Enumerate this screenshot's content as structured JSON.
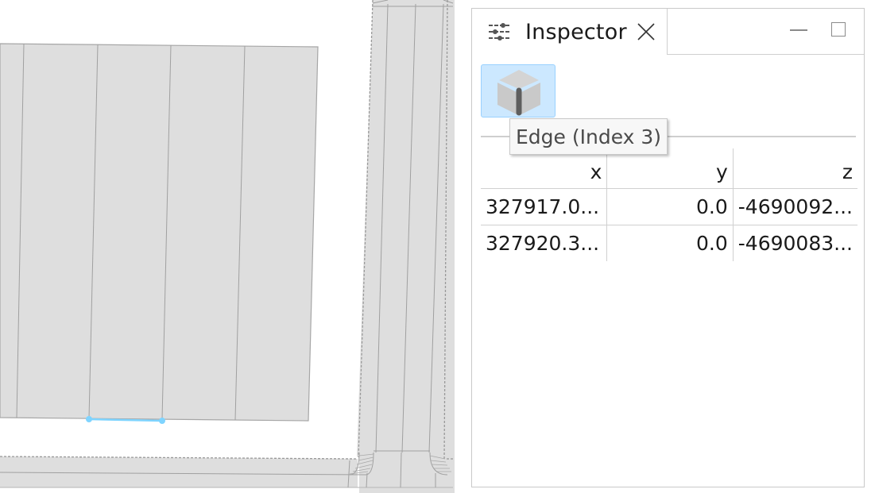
{
  "viewport": {
    "selection_color": "#7fd4ff",
    "mesh_fill": "#dedede",
    "mesh_edge": "#9a9a9a"
  },
  "inspector": {
    "tab_title": "Inspector",
    "tab_icon": "sliders-icon",
    "close_icon": "close-icon",
    "minimize_icon": "minimize-icon",
    "maximize_icon": "maximize-icon",
    "selection_type_icon": "cube-edge-icon",
    "tooltip": "Edge (Index 3)",
    "table": {
      "columns": [
        "x",
        "y",
        "z"
      ],
      "rows": [
        [
          "327917.0...",
          "0.0",
          "-4690092..."
        ],
        [
          "327920.3...",
          "0.0",
          "-4690083..."
        ]
      ]
    }
  }
}
